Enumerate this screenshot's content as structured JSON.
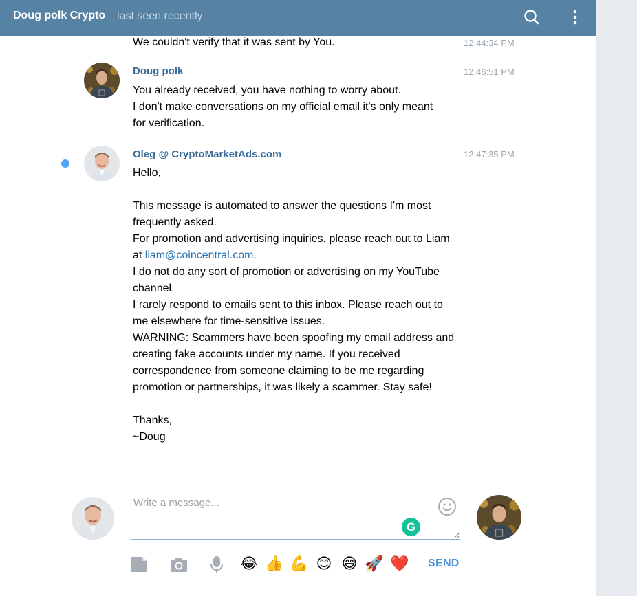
{
  "header": {
    "title": "Doug polk Crypto",
    "status": "last seen recently"
  },
  "messages": [
    {
      "author": "",
      "time": "12:44:34 PM",
      "text": "We couldn't verify that it was sent by You."
    },
    {
      "author": "Doug polk",
      "time": "12:46:51 PM",
      "text": "You already received, you have nothing to worry about.\nI don't make conversations on my official email it's only meant\nfor verification."
    },
    {
      "author": "Oleg @ CryptoMarketAds.com",
      "time": "12:47:35 PM",
      "text_before_link": "Hello,\n\nThis message is automated to answer the questions I'm most\nfrequently asked.\nFor promotion and advertising inquiries, please reach out to Liam\nat ",
      "link": "liam@coincentral.com",
      "text_after_link": ".\nI do not do any sort of promotion or advertising on my YouTube\nchannel.\nI rarely respond to emails sent to this inbox. Please reach out to\nme elsewhere for time-sensitive issues.\nWARNING: Scammers have been spoofing my email address and\ncreating fake accounts under my name. If you received\ncorrespondence from someone claiming to be me regarding\npromotion or partnerships, it was likely a scammer. Stay safe!\n\nThanks,\n~Doug"
    }
  ],
  "composer": {
    "placeholder": "Write a message...",
    "send_label": "SEND",
    "grammarly_letter": "G",
    "quick_emojis": [
      "😂",
      "👍",
      "💪",
      "😊",
      "😅",
      "🚀",
      "❤️"
    ]
  },
  "colors": {
    "header_bg": "#5682a3",
    "author": "#3a6d99",
    "link": "#2a6fb0",
    "send": "#4a95dd",
    "unread_dot": "#4ea4f6"
  },
  "icons": {
    "header": [
      "search-icon",
      "more-vertical-icon"
    ],
    "toolbar": [
      "document-icon",
      "camera-icon",
      "microphone-icon"
    ],
    "composer": [
      "smiley-icon"
    ]
  }
}
